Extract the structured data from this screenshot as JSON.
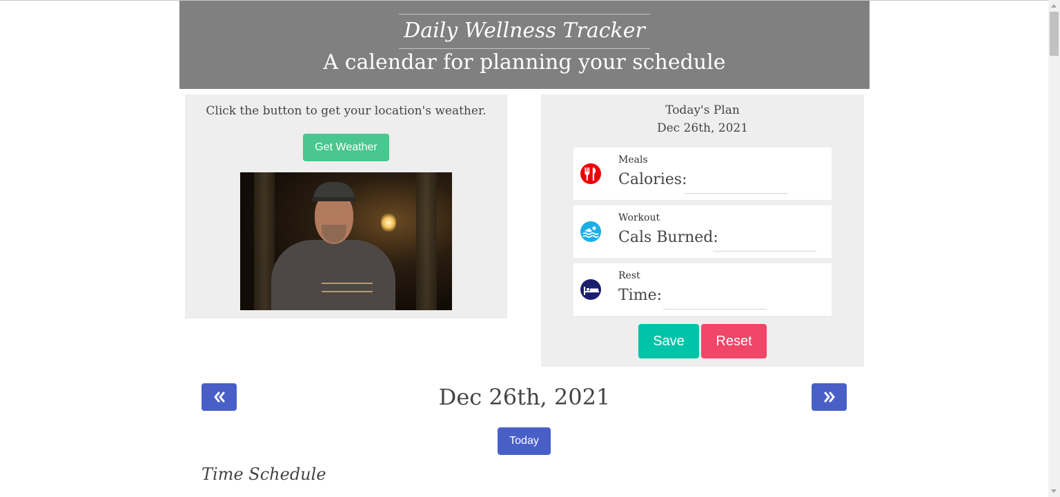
{
  "header": {
    "title": "Daily Wellness Tracker",
    "subtitle": "A calendar for planning your schedule"
  },
  "weather": {
    "prompt": "Click the button to get your location's weather.",
    "button_label": "Get Weather"
  },
  "plan": {
    "heading": "Today's Plan",
    "date": "Dec 26th, 2021",
    "cards": [
      {
        "category": "Meals",
        "field_label": "Calories:",
        "value": "",
        "icon": "utensils-icon",
        "icon_color": "#ee0000"
      },
      {
        "category": "Workout",
        "field_label": "Cals Burned:",
        "value": "",
        "icon": "swimmer-icon",
        "icon_color": "#1ab0e6"
      },
      {
        "category": "Rest",
        "field_label": "Time:",
        "value": "",
        "icon": "bed-icon",
        "icon_color": "#1a1f6e"
      }
    ],
    "save_label": "Save",
    "reset_label": "Reset"
  },
  "calendar": {
    "prev_icon": "double-chevron-left-icon",
    "next_icon": "double-chevron-right-icon",
    "current_date": "Dec 26th, 2021",
    "today_label": "Today"
  },
  "schedule": {
    "title": "Time Schedule"
  },
  "colors": {
    "header_bg": "#808080",
    "panel_bg": "#eeeeee",
    "weather_button": "#48c78e",
    "save_button": "#00c4a7",
    "reset_button": "#f14668",
    "nav_button": "#485fc7"
  }
}
